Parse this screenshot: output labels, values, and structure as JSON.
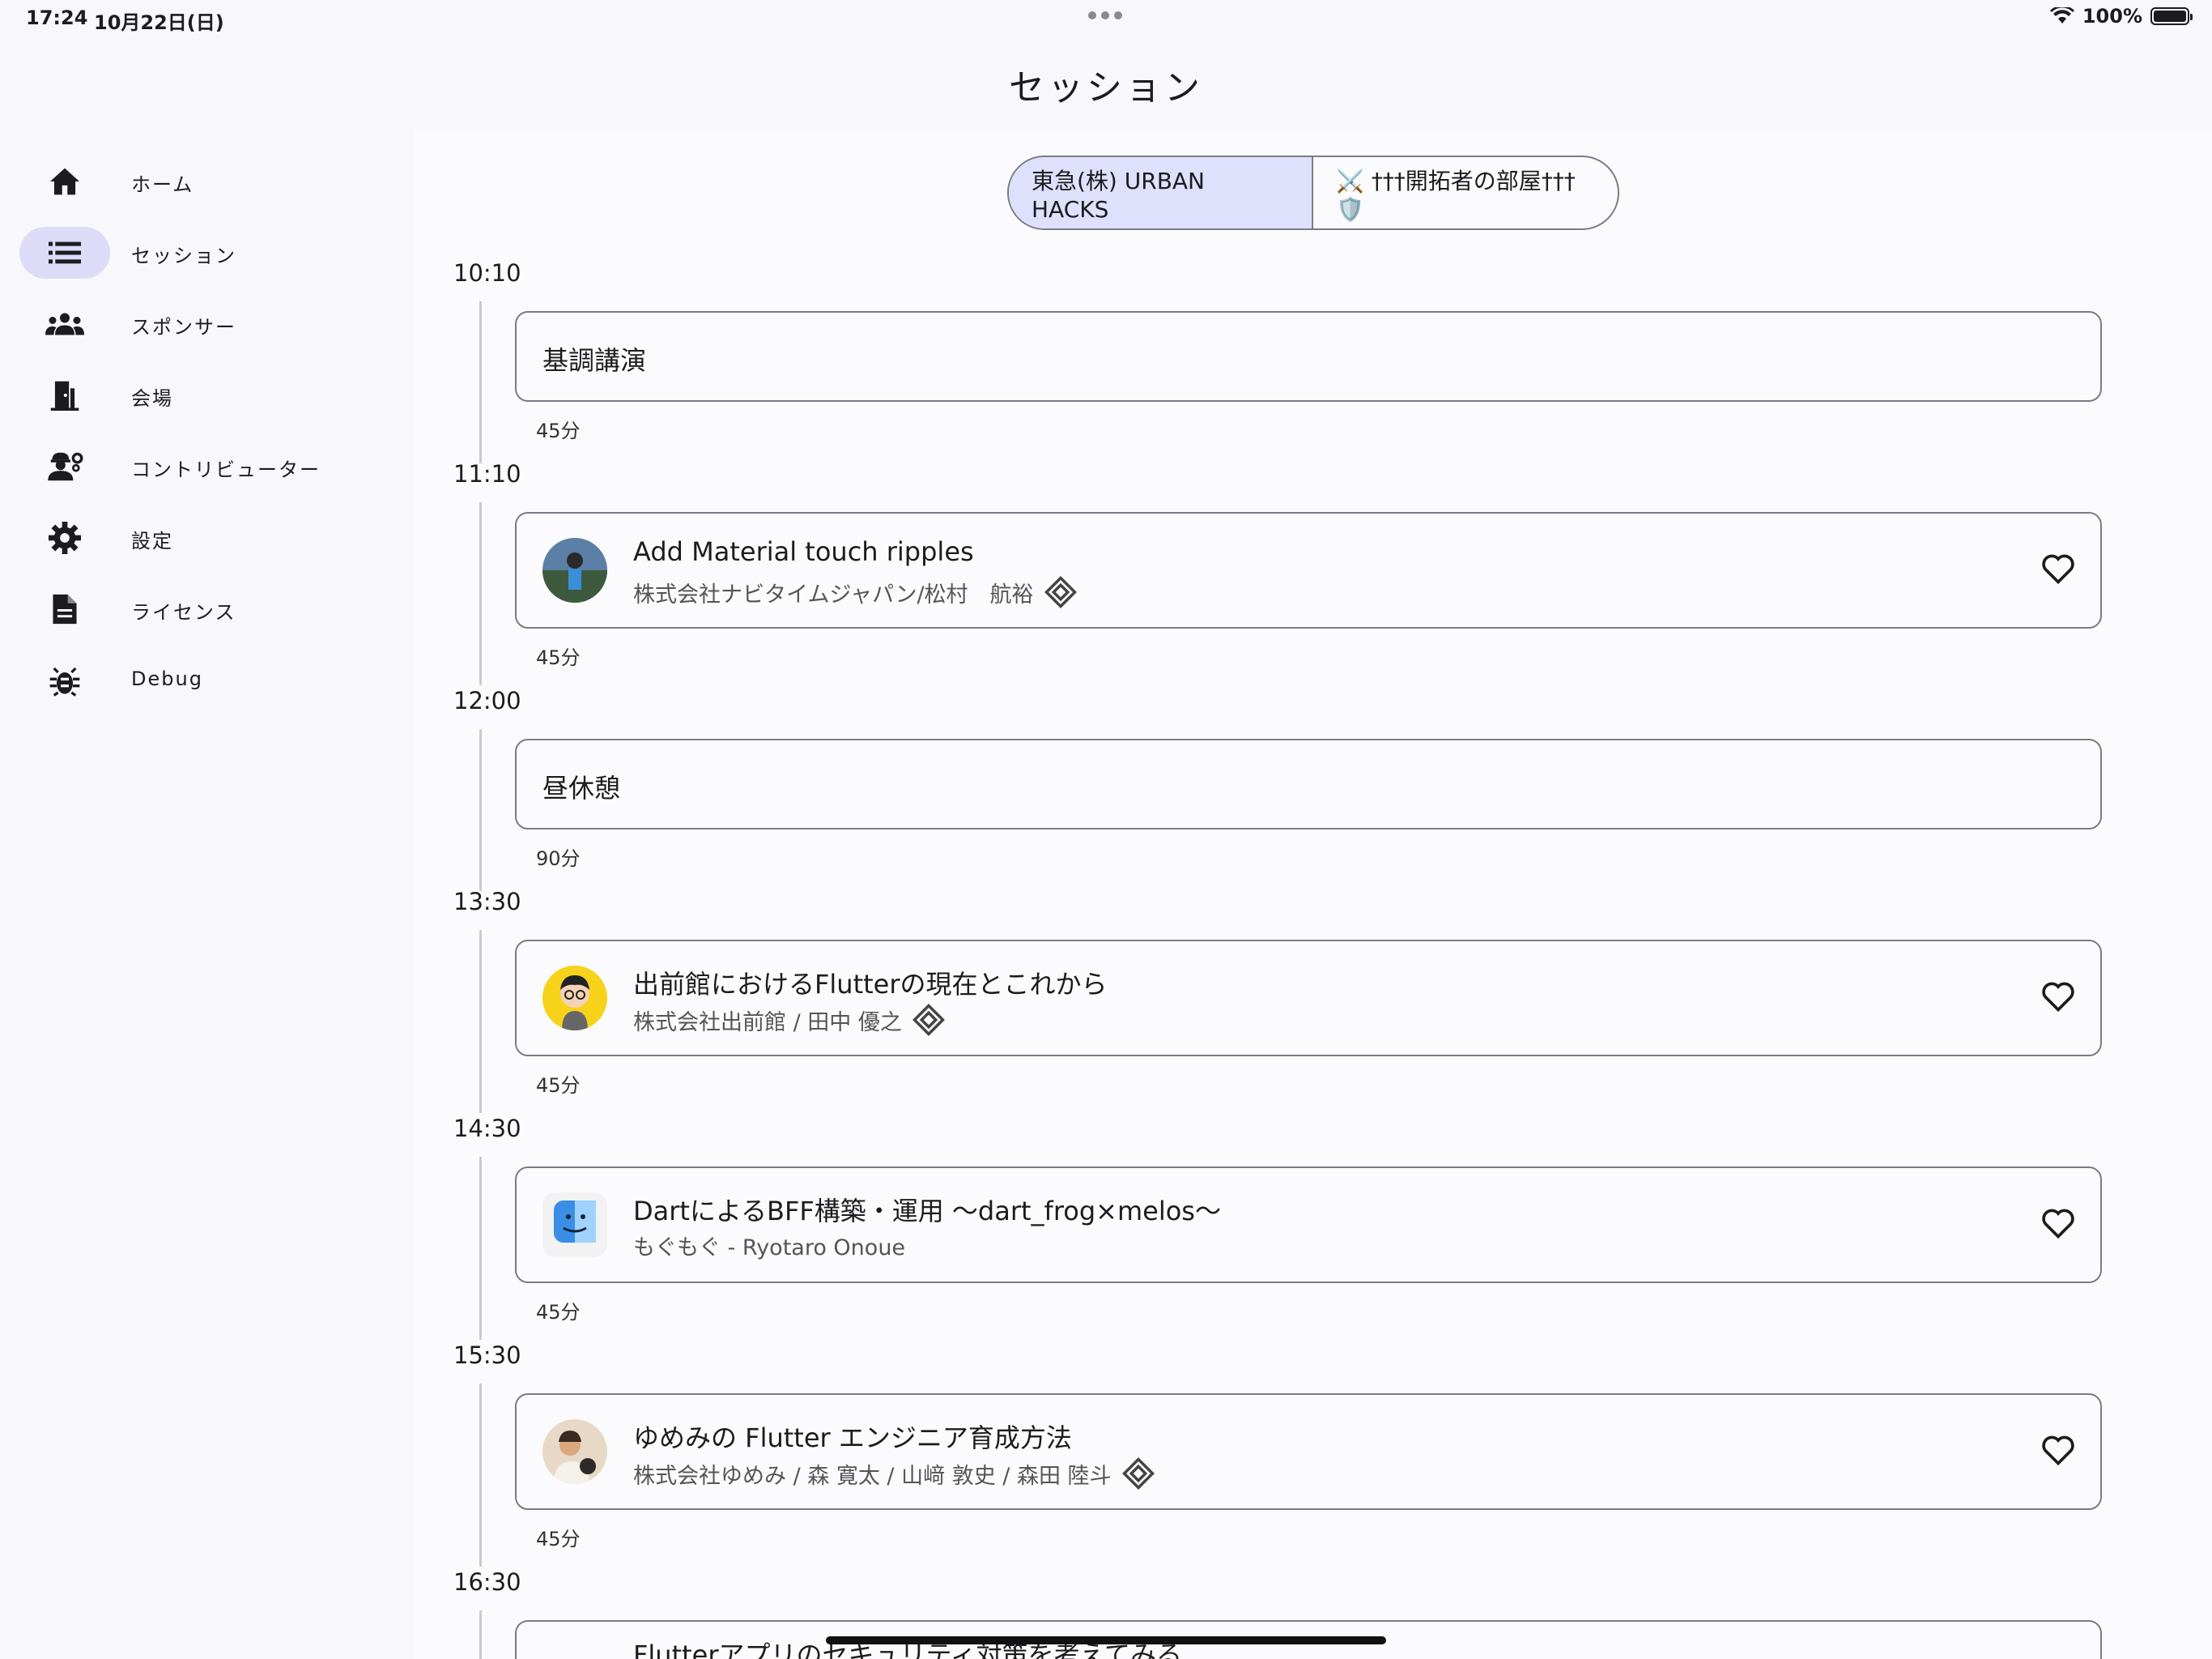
{
  "status_bar": {
    "time": "17:24",
    "date": "10月22日(日)",
    "battery": "100%"
  },
  "page_title": "セッション",
  "sidebar": {
    "items": [
      {
        "label": "ホーム",
        "icon": "home-icon"
      },
      {
        "label": "セッション",
        "icon": "list-icon",
        "active": true
      },
      {
        "label": "スポンサー",
        "icon": "groups-icon"
      },
      {
        "label": "会場",
        "icon": "door-icon"
      },
      {
        "label": "コントリビューター",
        "icon": "engineering-icon"
      },
      {
        "label": "設定",
        "icon": "gear-icon"
      },
      {
        "label": "ライセンス",
        "icon": "document-icon"
      },
      {
        "label": "Debug",
        "icon": "bug-icon"
      }
    ]
  },
  "room_tabs": {
    "selected": "東急(株) URBAN HACKS",
    "other": "⚔️ †††開拓者の部屋†††🛡️"
  },
  "sessions": [
    {
      "time": "10:10",
      "title": "基調講演",
      "duration": "45分"
    },
    {
      "time": "11:10",
      "title": "Add Material touch ripples",
      "speaker": "株式会社ナビタイムジャパン/松村　航裕",
      "duration": "45分"
    },
    {
      "time": "12:00",
      "title": "昼休憩",
      "duration": "90分"
    },
    {
      "time": "13:30",
      "title": "出前館におけるFlutterの現在とこれから",
      "speaker": "株式会社出前館 / 田中 優之",
      "duration": "45分"
    },
    {
      "time": "14:30",
      "title": "DartによるBFF構築・運用 〜dart_frog×melos〜",
      "speaker": "もぐもぐ - Ryotaro Onoue",
      "duration": "45分"
    },
    {
      "time": "15:30",
      "title": "ゆめみの Flutter エンジニア育成方法",
      "speaker": "株式会社ゆめみ / 森 寛太 / 山﨑 敦史 / 森田 陸斗",
      "duration": "45分"
    },
    {
      "time": "16:30",
      "title": "Flutterアプリのセキュリティ対策を考えてみる"
    }
  ],
  "colors": {
    "accent_pill": "#dcdcf8",
    "border": "#7b7a87",
    "background": "#f8f8fc"
  }
}
